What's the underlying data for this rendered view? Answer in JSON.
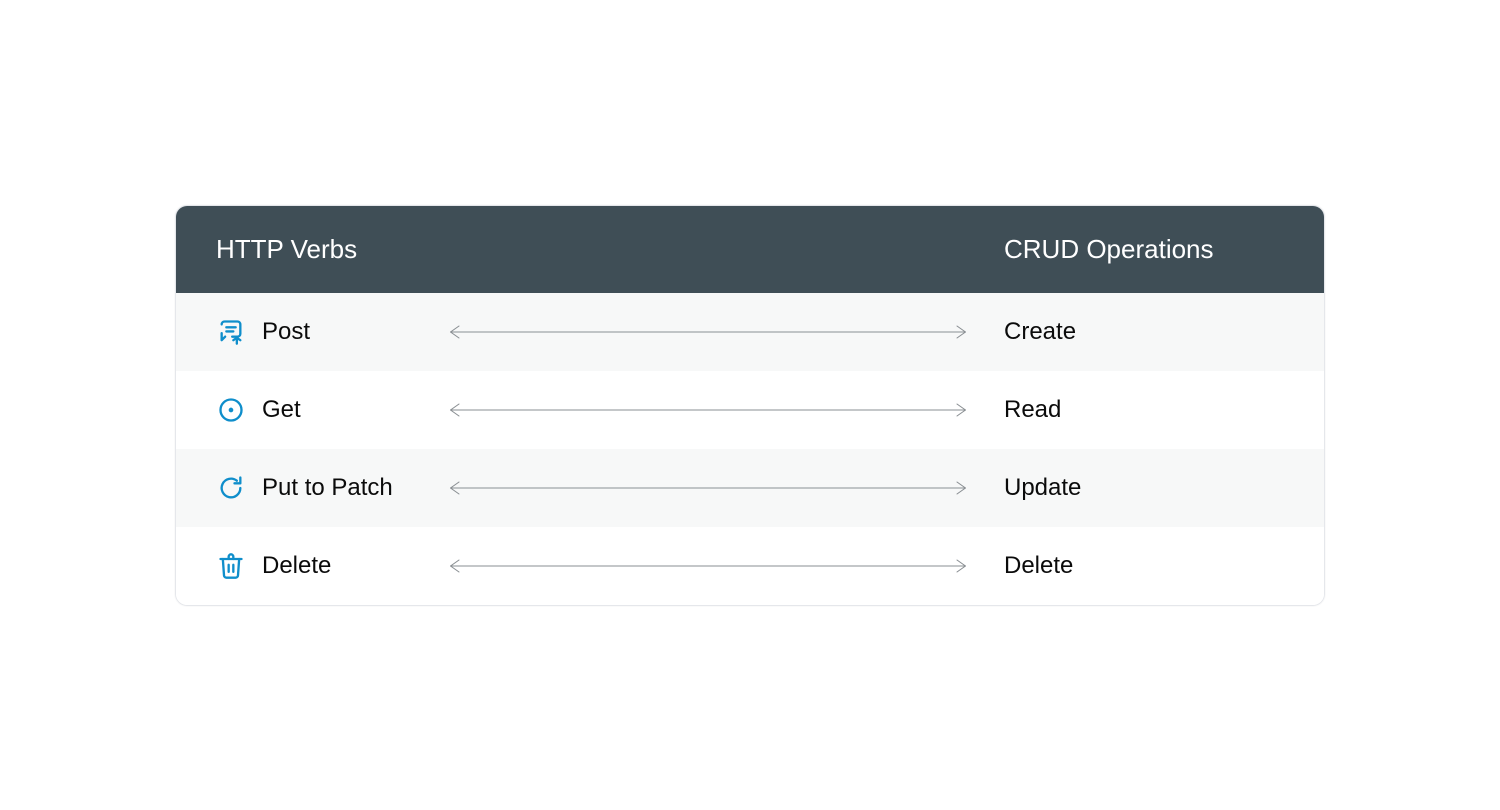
{
  "colors": {
    "header_bg": "#3f4e56",
    "header_text": "#ffffff",
    "row_alt_bg": "#f7f8f8",
    "row_bg": "#ffffff",
    "icon_stroke": "#0f8ecb",
    "text": "#0b0b0b",
    "arrow": "#8a8f93"
  },
  "header": {
    "left": "HTTP Verbs",
    "right": "CRUD Operations"
  },
  "rows": [
    {
      "icon": "message-share-icon",
      "verb": "Post",
      "crud": "Create"
    },
    {
      "icon": "record-dot-icon",
      "verb": "Get",
      "crud": "Read"
    },
    {
      "icon": "refresh-icon",
      "verb": "Put to Patch",
      "crud": "Update"
    },
    {
      "icon": "trash-icon",
      "verb": "Delete",
      "crud": "Delete"
    }
  ]
}
